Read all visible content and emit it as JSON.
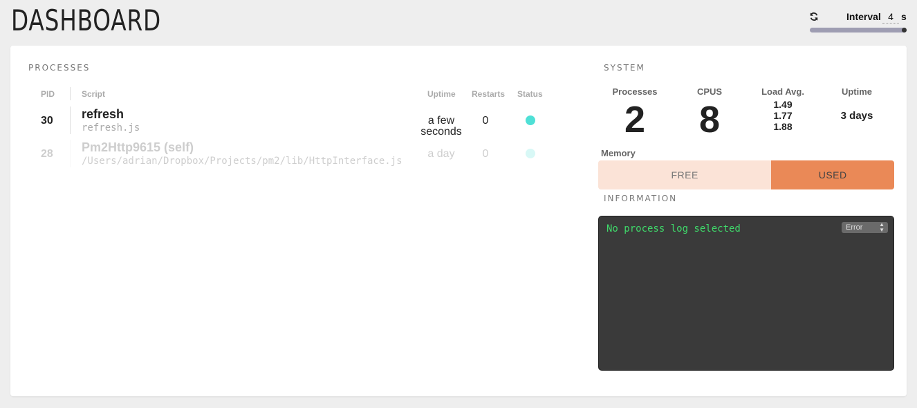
{
  "header": {
    "title": "DASHBOARD",
    "interval_label": "Interval",
    "interval_value": "4",
    "interval_unit": "s",
    "interval_slider_level": 1.0
  },
  "processes": {
    "title": "PROCESSES",
    "columns": {
      "pid": "PID",
      "script": "Script",
      "uptime": "Uptime",
      "restarts": "Restarts",
      "status": "Status"
    },
    "rows": [
      {
        "pid": "30",
        "name": "refresh",
        "path": "refresh.js",
        "uptime_line1": "a few",
        "uptime_line2": "seconds",
        "restarts": "0",
        "status_color": "#4fe0d6"
      },
      {
        "pid": "28",
        "name": "Pm2Http9615 (self)",
        "path": "/Users/adrian/Dropbox/Projects/pm2/lib/HttpInterface.js",
        "uptime_line1": "a day",
        "uptime_line2": "",
        "restarts": "0",
        "status_color": "#4fe0d6"
      }
    ]
  },
  "system": {
    "title": "SYSTEM",
    "processes_label": "Processes",
    "processes_value": "2",
    "cpus_label": "CPUS",
    "cpus_value": "8",
    "load_label": "Load Avg.",
    "load_values": [
      "1.49",
      "1.77",
      "1.88"
    ],
    "uptime_label": "Uptime",
    "uptime_value": "3 days",
    "memory_label": "Memory",
    "memory_free_label": "FREE",
    "memory_used_label": "USED",
    "memory_used_fraction": 0.415,
    "free_color": "#fbe3d7",
    "used_color": "#ea8957"
  },
  "information": {
    "title": "INFORMATION",
    "log_message": "No process log selected",
    "log_level_selected": "Error",
    "log_text_color": "#3fd96a"
  }
}
